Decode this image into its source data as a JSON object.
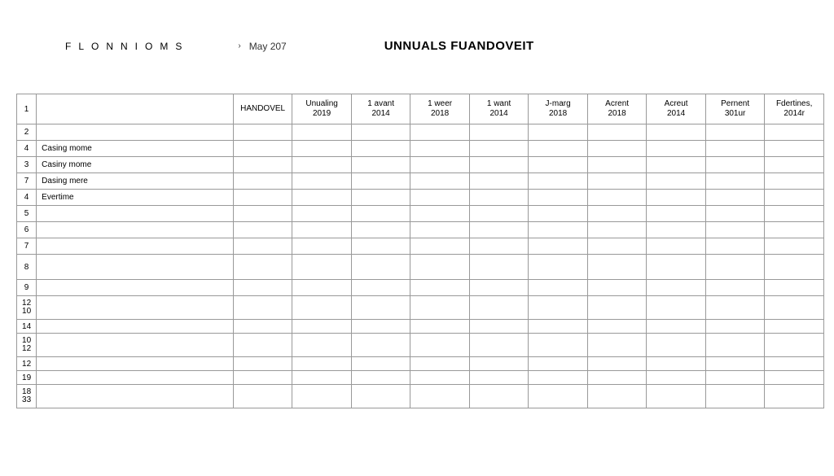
{
  "header": {
    "brand": "FLONNIOMS",
    "breadcrumb_label": "May 207",
    "title": "UNNUALS FUANDOVEIT"
  },
  "table": {
    "columns": [
      "HANDOVEL",
      "Unualing 2019",
      "1 avant 2014",
      "1 weer 2018",
      "1 want 2014",
      "J-marg 2018",
      "Acrent 2018",
      "Acreut 2014",
      "Pernent 301ur",
      "Fdertines, 2014r"
    ],
    "rows": [
      {
        "num": "1",
        "label": "",
        "header": true
      },
      {
        "num": "2",
        "label": ""
      },
      {
        "num": "4",
        "label": "Casing mome"
      },
      {
        "num": "3",
        "label": "Casiny mome"
      },
      {
        "num": "7",
        "label": "Dasing mere"
      },
      {
        "num": "4",
        "label": "Evertime"
      },
      {
        "num": "5",
        "label": ""
      },
      {
        "num": "6",
        "label": ""
      },
      {
        "num": "7",
        "label": ""
      },
      {
        "num": "8",
        "label": "",
        "tall": true
      },
      {
        "num": "9",
        "label": ""
      },
      {
        "num": "12\n10",
        "label": ""
      },
      {
        "num": "14",
        "label": "",
        "short": true
      },
      {
        "num": "10\n12",
        "label": ""
      },
      {
        "num": "12",
        "label": "",
        "short": true
      },
      {
        "num": "19",
        "label": "",
        "short": true
      },
      {
        "num": "18\n33",
        "label": ""
      }
    ]
  }
}
